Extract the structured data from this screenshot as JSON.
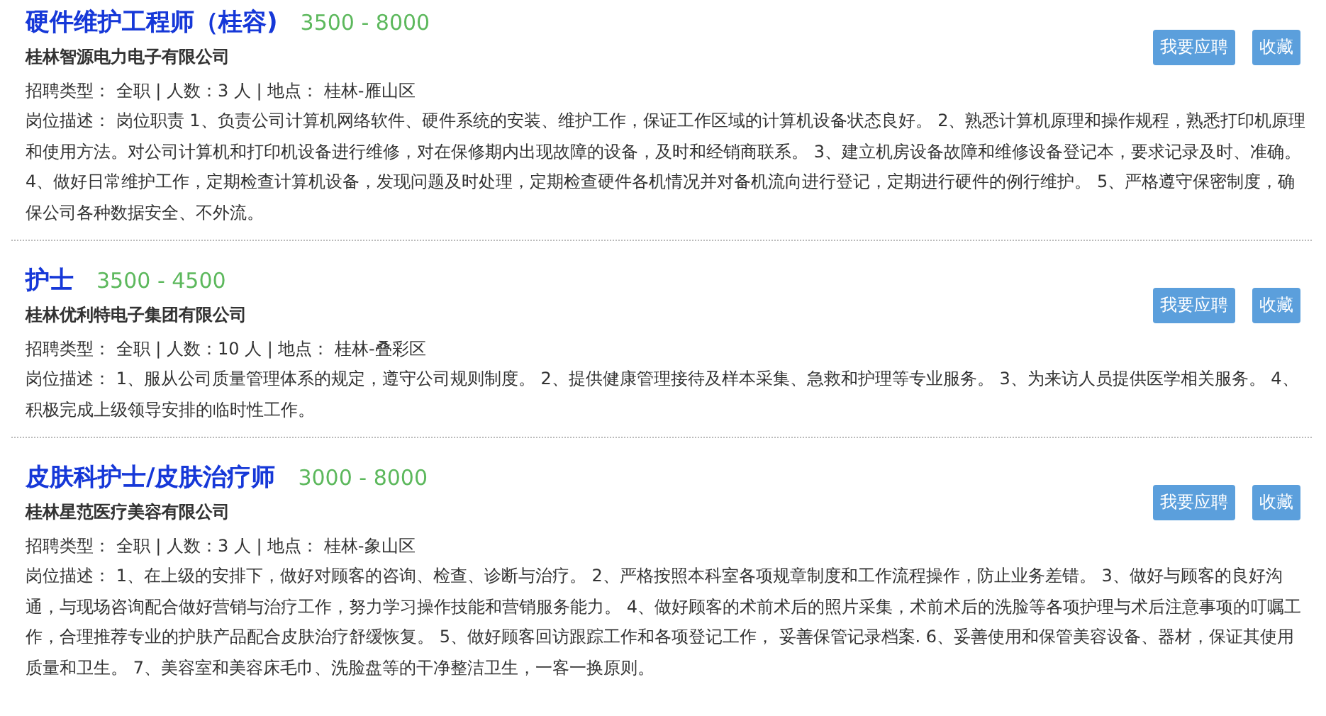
{
  "jobs": [
    {
      "title": "硬件维护工程师（桂容)",
      "salary": "3500 - 8000",
      "company": "桂林智源电力电子有限公司",
      "meta": "招聘类型： 全职 | 人数：3 人 | 地点： 桂林-雁山区",
      "description": "岗位描述： 岗位职责 1、负责公司计算机网络软件、硬件系统的安装、维护工作，保证工作区域的计算机设备状态良好。 2、熟悉计算机原理和操作规程，熟悉打印机原理和使用方法。对公司计算机和打印机设备进行维修，对在保修期内出现故障的设备，及时和经销商联系。 3、建立机房设备故障和维修设备登记本，要求记录及时、准确。 4、做好日常维护工作，定期检查计算机设备，发现问题及时处理，定期检查硬件各机情况并对备机流向进行登记，定期进行硬件的例行维护。 5、严格遵守保密制度，确保公司各种数据安全、不外流。",
      "buttons": [
        "我要应聘",
        "收藏"
      ]
    },
    {
      "title": "护士",
      "salary": "3500 - 4500",
      "company": "桂林优利特电子集团有限公司",
      "meta": "招聘类型： 全职 | 人数：10 人 | 地点： 桂林-叠彩区",
      "description": "岗位描述： 1、服从公司质量管理体系的规定，遵守公司规则制度。 2、提供健康管理接待及样本采集、急救和护理等专业服务。 3、为来访人员提供医学相关服务。 4、积极完成上级领导安排的临时性工作。",
      "buttons": [
        "我要应聘",
        "收藏"
      ]
    },
    {
      "title": "皮肤科护士/皮肤治疗师",
      "salary": "3000 - 8000",
      "company": "桂林星范医疗美容有限公司",
      "meta": "招聘类型： 全职 | 人数：3 人 | 地点： 桂林-象山区",
      "description": "岗位描述： 1、在上级的安排下，做好对顾客的咨询、检查、诊断与治疗。 2、严格按照本科室各项规章制度和工作流程操作，防止业务差错。 3、做好与顾客的良好沟通，与现场咨询配合做好营销与治疗工作，努力学习操作技能和营销服务能力。 4、做好顾客的术前术后的照片采集，术前术后的洗脸等各项护理与术后注意事项的叮嘱工作，合理推荐专业的护肤产品配合皮肤治疗舒缓恢复。 5、做好顾客回访跟踪工作和各项登记工作， 妥善保管记录档案. 6、妥善使用和保管美容设备、器材，保证其使用质量和卫生。 7、美容室和美容床毛巾、洗脸盘等的干净整洁卫生，一客一换原则。",
      "buttons": [
        "我要应聘",
        "收藏"
      ]
    }
  ]
}
